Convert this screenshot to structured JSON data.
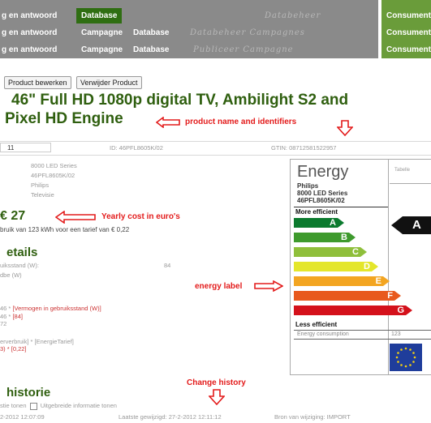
{
  "nav": {
    "row1": [
      "g en antwoord",
      "Database",
      "Databeheer"
    ],
    "row2": [
      "g en antwoord",
      "Campagne",
      "Database",
      "Databeheer Campagnes"
    ],
    "row3": [
      "g en antwoord",
      "Campagne",
      "Database",
      "Publiceer Campagne"
    ],
    "right": [
      "Consument",
      "Consument",
      "Consument"
    ]
  },
  "buttons": {
    "edit": "Product bewerken",
    "delete": "Verwijder Product"
  },
  "product": {
    "title_line1": "46\" Full HD 1080p digital TV, Ambilight S2 and",
    "title_line2": "Pixel HD Engine",
    "input_value": "11",
    "id_text": "ID: 46PFL8605K/02",
    "gtin_text": "GTIN: 08712581522957",
    "specs": [
      "8000 LED Series",
      "46PFL8605K/02",
      "Philips",
      "Televisie"
    ]
  },
  "cost": {
    "price": "€ 27",
    "usage": "bruik van 123 kWh voor een tarief van € 0,22"
  },
  "details": {
    "heading": "etails",
    "row1_label": "uiksstand (W):",
    "row1_value": "84",
    "row2_label": "dbe (W)",
    "formula1a": "46 * ",
    "formula1b": "[Vermogen in gebruiksstand (W)]",
    "formula2a": "46 * ",
    "formula2b": "[84]",
    "formula3": "72",
    "formula4a": "erverbruik] * [EnergieTarief]",
    "formula5": "3) * [0,22]"
  },
  "history": {
    "heading": "historie",
    "toggle_text": "stie tonen",
    "checkbox_label": "Uitgebreide informatie tonen",
    "date": "2-2012 12:07:09",
    "last_changed": "Laatste gewijzigd: 27-2-2012 12:11:12",
    "source": "Bron van wijziging: IMPORT"
  },
  "annotations": {
    "name": "product name and identifiers",
    "cost": "Yearly cost in euro's",
    "label": "energy label",
    "history": "Change history"
  },
  "energy_label": {
    "title": "Energy",
    "brand": "Philips",
    "series": "8000 LED Series",
    "model": "46PFL8605K/02",
    "more": "More efficient",
    "less": "Less efficient",
    "consumption_label": "Energy consumption",
    "consumption_value": "123",
    "tab": "Tabelle",
    "rating": "A",
    "classes": [
      "A",
      "B",
      "C",
      "D",
      "E",
      "F",
      "G"
    ],
    "colors": [
      "#0b7a2e",
      "#3e9a2d",
      "#8fbf3b",
      "#e4e62b",
      "#f3a521",
      "#e8591d",
      "#d4111b"
    ]
  }
}
